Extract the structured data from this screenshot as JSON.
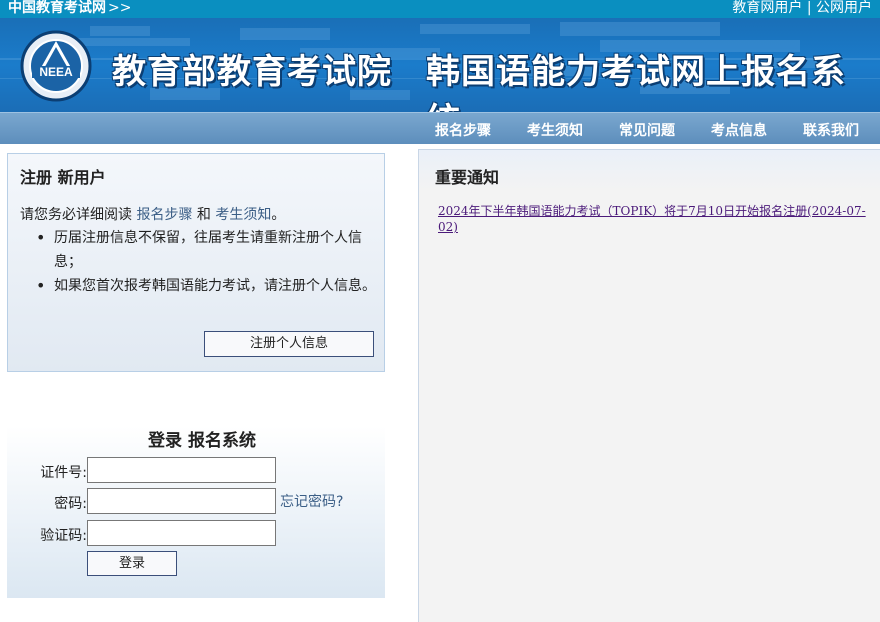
{
  "topbar": {
    "site_link": "中国教育考试网",
    "arrow": ">>",
    "user_links": "教育网用户 | 公网用户"
  },
  "banner": {
    "logo_text": "NEEA",
    "title1": "教育部教育考试院",
    "title2": "韩国语能力考试网上报名系统"
  },
  "nav": {
    "items": [
      "报名步骤",
      "考生须知",
      "常见问题",
      "考点信息",
      "联系我们"
    ]
  },
  "register": {
    "heading": "注册 新用户",
    "intro_prefix": "请您务必详细阅读",
    "link_steps": "报名步骤",
    "intro_and": "和",
    "link_notice": "考生须知",
    "intro_suffix": "。",
    "bullets": [
      "历届注册信息不保留，往届考生请重新注册个人信息；",
      "如果您首次报考韩国语能力考试，请注册个人信息。"
    ],
    "button": "注册个人信息"
  },
  "login": {
    "heading": "登录 报名系统",
    "id_label": "证件号:",
    "password_label": "密码:",
    "captcha_label": "验证码:",
    "forgot": "忘记密码?",
    "submit": "登录"
  },
  "notice": {
    "heading": "重要通知",
    "items": [
      "2024年下半年韩国语能力考试（TOPIK）将于7月10日开始报名注册(2024-07-02)"
    ]
  }
}
